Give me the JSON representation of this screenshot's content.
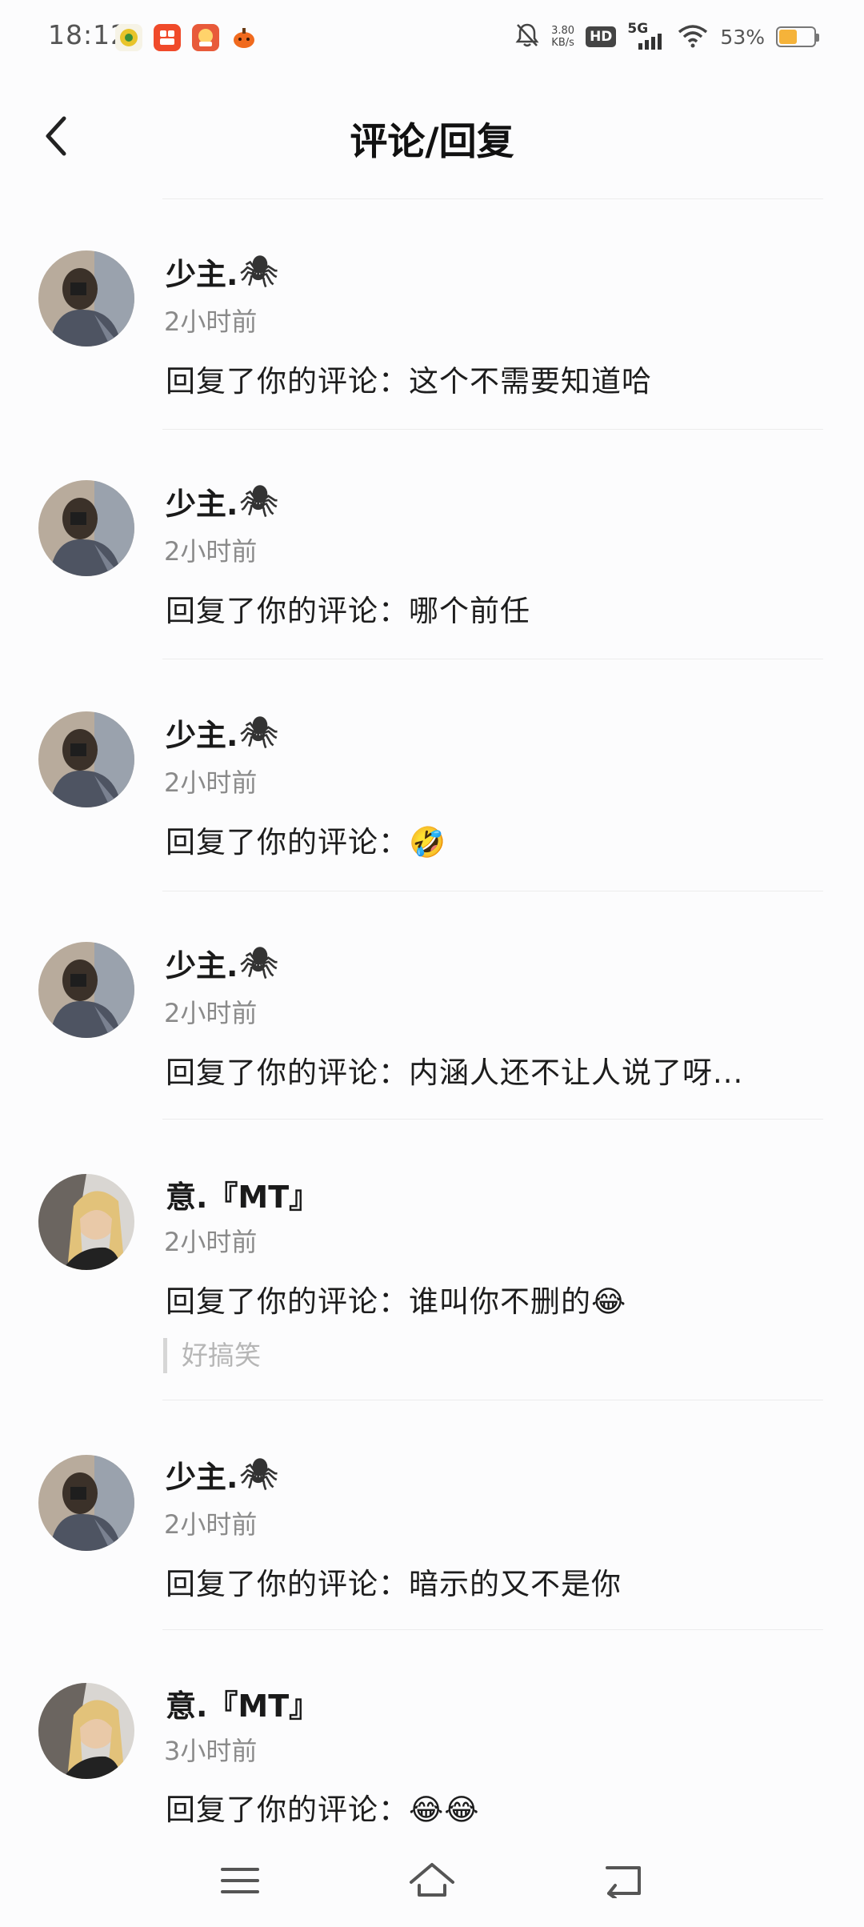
{
  "status_bar": {
    "time": "18:12",
    "net_speed_value": "3.80",
    "net_speed_unit": "KB/s",
    "hd_label": "HD",
    "signal_label": "5G",
    "battery_percent": "53%",
    "battery_level": 0.53,
    "colors": {
      "battery": "#f5b33a"
    },
    "icons": [
      "mute-bell-icon",
      "wifi-icon",
      "battery-icon"
    ]
  },
  "header": {
    "title": "评论/回复",
    "back_icon": "chevron-left-icon"
  },
  "notifications": [
    {
      "user": "少主.",
      "user_emoji": "🕷",
      "time": "2小时前",
      "text": "回复了你的评论：这个不需要知道哈",
      "quote": ""
    },
    {
      "user": "少主.",
      "user_emoji": "🕷",
      "time": "2小时前",
      "text": "回复了你的评论：哪个前任",
      "quote": ""
    },
    {
      "user": "少主.",
      "user_emoji": "🕷",
      "time": "2小时前",
      "text": "回复了你的评论：🤣",
      "quote": ""
    },
    {
      "user": "少主.",
      "user_emoji": "🕷",
      "time": "2小时前",
      "text": "回复了你的评论：内涵人还不让人说了呀...",
      "quote": ""
    },
    {
      "user": "意.『MT』",
      "user_emoji": "",
      "time": "2小时前",
      "text": "回复了你的评论：谁叫你不删的😂",
      "quote": "好搞笑"
    },
    {
      "user": "少主.",
      "user_emoji": "🕷",
      "time": "2小时前",
      "text": "回复了你的评论：暗示的又不是你",
      "quote": ""
    },
    {
      "user": "意.『MT』",
      "user_emoji": "",
      "time": "3小时前",
      "text": "回复了你的评论：😂😂",
      "quote": ""
    }
  ],
  "nav_bar": {
    "icons": [
      "menu-icon",
      "home-icon",
      "back-icon"
    ]
  }
}
